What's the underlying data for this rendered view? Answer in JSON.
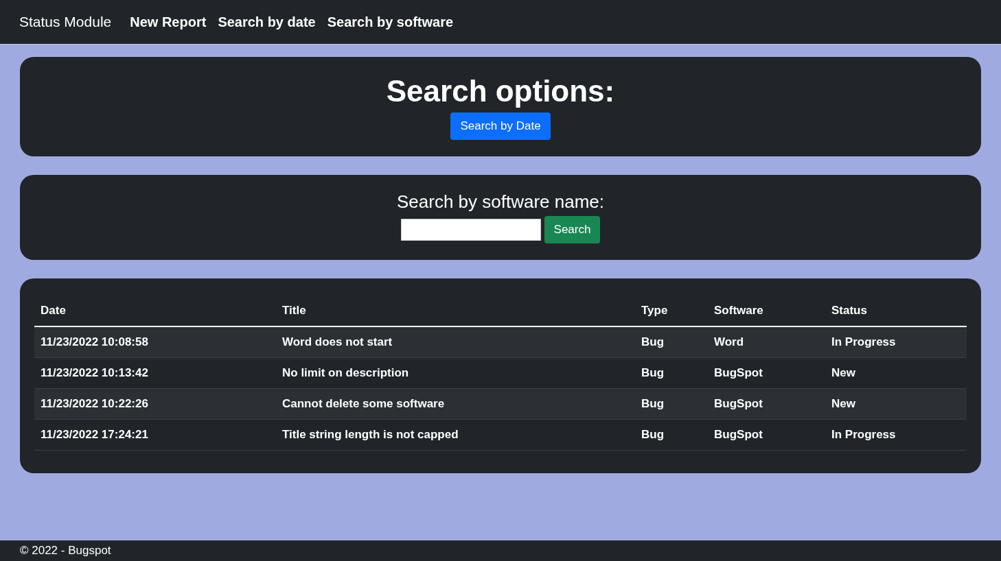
{
  "navbar": {
    "brand": "Status Module",
    "links": [
      "New Report",
      "Search by date",
      "Search by software"
    ]
  },
  "search_options": {
    "heading": "Search options:",
    "button": "Search by Date"
  },
  "software_search": {
    "heading": "Search by software name:",
    "button": "Search"
  },
  "table": {
    "columns": [
      "Date",
      "Title",
      "Type",
      "Software",
      "Status"
    ],
    "rows": [
      {
        "cells": [
          "11/23/2022 10:08:58",
          "Word does not start",
          "Bug",
          "Word",
          "In Progress"
        ]
      },
      {
        "cells": [
          "11/23/2022 10:13:42",
          "No limit on description",
          "Bug",
          "BugSpot",
          "New"
        ]
      },
      {
        "cells": [
          "11/23/2022 10:22:26",
          "Cannot delete some software",
          "Bug",
          "BugSpot",
          "New"
        ]
      },
      {
        "cells": [
          "11/23/2022 17:24:21",
          "Title string length is not capped",
          "Bug",
          "BugSpot",
          "In Progress"
        ]
      }
    ]
  },
  "footer": {
    "text": "© 2022 - Bugspot"
  }
}
